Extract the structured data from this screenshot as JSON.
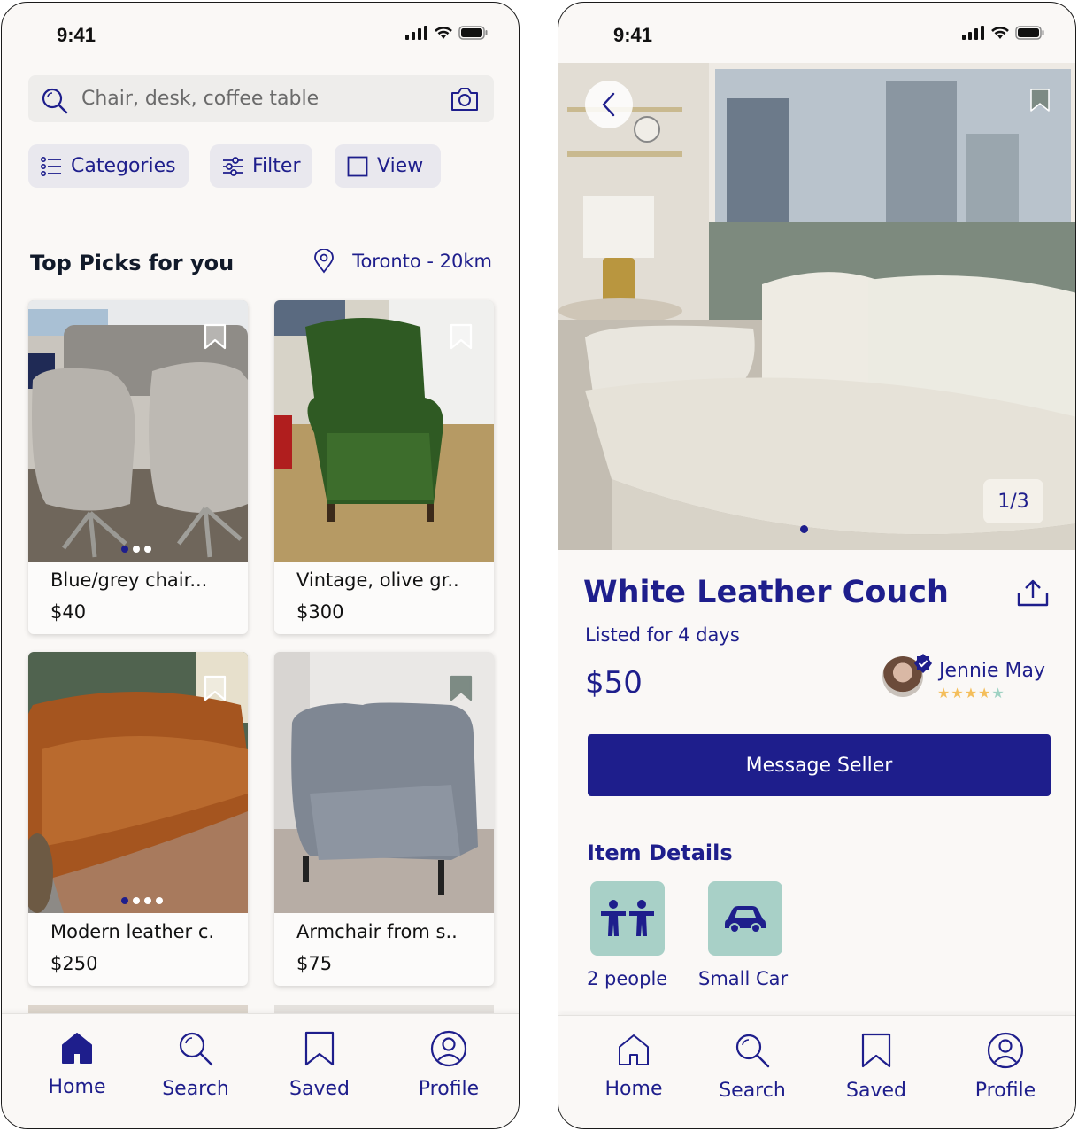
{
  "status": {
    "time": "9:41"
  },
  "browse": {
    "search": {
      "placeholder": "Chair, desk, coffee table"
    },
    "chips": {
      "categories": "Categories",
      "filter": "Filter",
      "view": "View"
    },
    "section_title": "Top Picks for you",
    "location": "Toronto - 20km",
    "listings": [
      {
        "title": "Blue/grey chair...",
        "price": "$40"
      },
      {
        "title": "Vintage, olive gr..",
        "price": "$300"
      },
      {
        "title": "Modern leather c.",
        "price": "$250"
      },
      {
        "title": "Armchair from s..",
        "price": "$75"
      }
    ]
  },
  "detail": {
    "image_counter": "1/3",
    "title": "White Leather Couch",
    "listed": "Listed for 4 days",
    "price": "$50",
    "seller": {
      "name": "Jennie May",
      "rating": 4
    },
    "message_button": "Message Seller",
    "details_title": "Item Details",
    "details": [
      {
        "label": "2 people",
        "icon": "people-icon"
      },
      {
        "label": "Small Car",
        "icon": "car-icon"
      }
    ]
  },
  "tabs": {
    "home": "Home",
    "search": "Search",
    "saved": "Saved",
    "profile": "Profile"
  },
  "colors": {
    "primary": "#1e1e8c",
    "tile": "#a8d0c7",
    "background": "#faf8f6",
    "star": "#f4be5b"
  }
}
